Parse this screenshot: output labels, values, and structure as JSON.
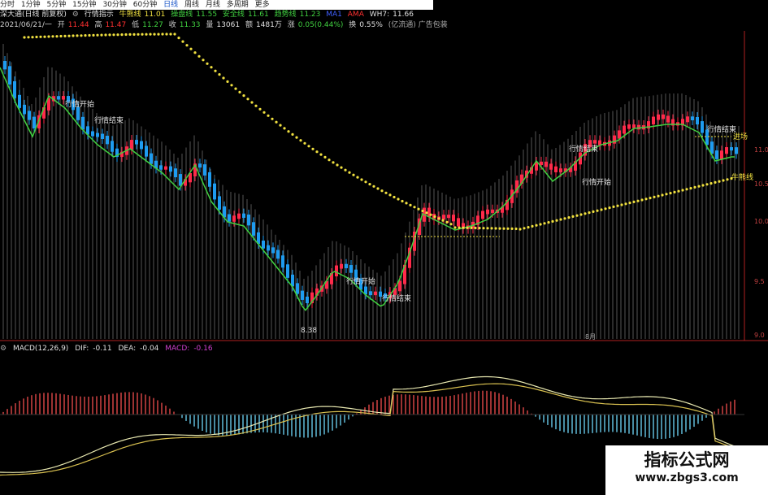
{
  "toolbar": {
    "items": [
      "分时",
      "1分钟",
      "5分钟",
      "15分钟",
      "30分钟",
      "60分钟",
      "日线",
      "周线",
      "月线",
      "多周期",
      "更多"
    ],
    "active_index": 6
  },
  "header": {
    "stock": "深大通(日线 前复权)",
    "indicator": "行情指示",
    "niu_label": "牛熊线",
    "niu_value": "11.01",
    "cao_label": "操盘线",
    "cao_value": "11.55",
    "safe_label": "安全线",
    "safe_value": "11.61",
    "trend_label": "趋势线",
    "trend_value": "11.23",
    "ma1": "MA1",
    "ma2": "AMA",
    "wh_label": "WH7:",
    "wh_value": "11.66"
  },
  "quote": {
    "date": "2021/06/21/一",
    "open_label": "开",
    "open": "11.44",
    "high_label": "高",
    "high": "11.47",
    "low_label": "低",
    "low": "11.27",
    "close_label": "收",
    "close": "11.33",
    "vol_label": "量",
    "vol": "13061",
    "amt_label": "额",
    "amt": "1481万",
    "chg_label": "涨",
    "chg": "0.05(0.44%)",
    "turn_label": "换",
    "turn": "0.55%",
    "extra": "(亿流通) 广告包装"
  },
  "annotations": {
    "low_price": "8.38",
    "signal_start": "行情开始",
    "signal_end": "行情结束",
    "enter": "进场",
    "niu_tag": "牛熊线",
    "month_mark": "8月"
  },
  "y_axis": [
    "11.0",
    "10.5",
    "10.0",
    "9.5",
    "9.0"
  ],
  "macd": {
    "title": "MACD(12,26,9)",
    "dif_label": "DIF:",
    "dif": "-0.11",
    "dea_label": "DEA:",
    "dea": "-0.04",
    "macd_label": "MACD:",
    "macd_value": "-0.16"
  },
  "watermark": {
    "title": "指标公式网",
    "url": "www.zbgs3.com"
  },
  "colors": {
    "up": "#ff2a4a",
    "down": "#1e9cf0",
    "yellow": "#f0e040",
    "green": "#40d040",
    "grid": "#9a9a9a"
  }
}
